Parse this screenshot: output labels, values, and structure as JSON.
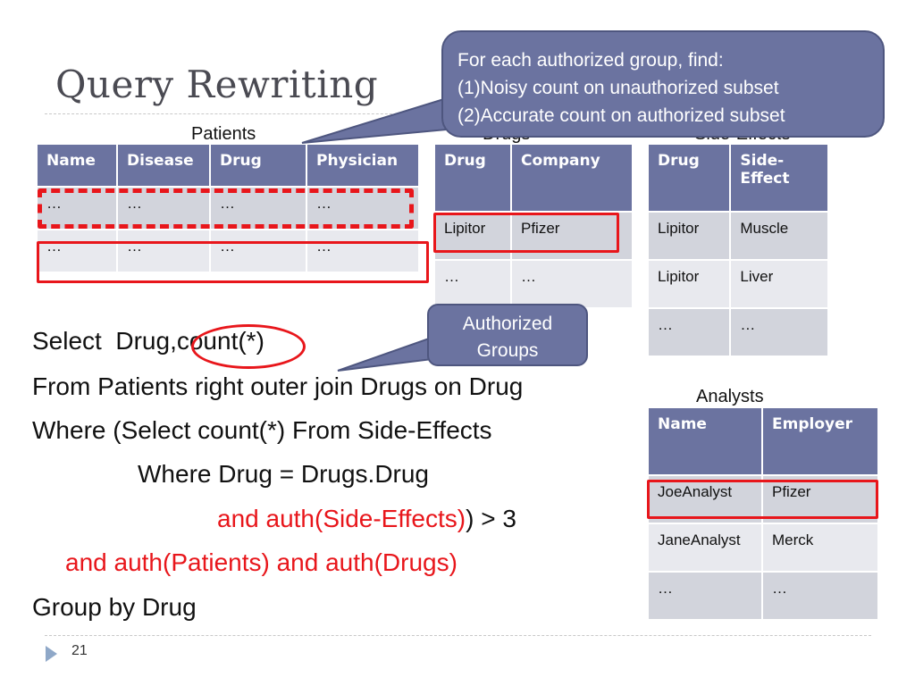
{
  "slide": {
    "title": "Query Rewriting",
    "page_number": "21"
  },
  "callouts": {
    "main": {
      "lines": [
        "For each authorized group, find:",
        "(1)Noisy count on unauthorized subset",
        "(2)Accurate count on authorized subset"
      ]
    },
    "authorized_groups": {
      "lines": [
        "Authorized",
        "Groups"
      ]
    }
  },
  "tables": {
    "patients": {
      "caption": "Patients",
      "headers": [
        "Name",
        "Disease",
        "Drug",
        "Physician"
      ],
      "rows": [
        [
          "…",
          "…",
          "…",
          "…"
        ],
        [
          "…",
          "…",
          "…",
          "…"
        ]
      ]
    },
    "drugs": {
      "caption": "Drugs",
      "headers": [
        "Drug",
        "Company"
      ],
      "rows": [
        [
          "Lipitor",
          "Pfizer"
        ],
        [
          "…",
          "…"
        ]
      ]
    },
    "side_effects": {
      "caption": "Side-Effects",
      "headers": [
        "Drug",
        "Side-Effect"
      ],
      "rows": [
        [
          "Lipitor",
          "Muscle"
        ],
        [
          "Lipitor",
          "Liver"
        ],
        [
          "…",
          "…"
        ]
      ]
    },
    "analysts": {
      "caption": "Analysts",
      "headers": [
        "Name",
        "Employer"
      ],
      "rows": [
        [
          "JoeAnalyst",
          "Pfizer"
        ],
        [
          "JaneAnalyst",
          "Merck"
        ],
        [
          "…",
          "…"
        ]
      ]
    }
  },
  "query": {
    "line1_prefix": "Select  Drug,",
    "line1_count": "count(*)",
    "line2": "From Patients right outer join Drugs on Drug",
    "line3": "Where (Select count(*) From Side-Effects",
    "line4": "Where Drug = Drugs.Drug",
    "line5_red": "and auth(Side-Effects)",
    "line5_rest": ") > 3",
    "line6_red": "and auth(Patients) and auth(Drugs)",
    "line7": "Group by Drug"
  },
  "colors": {
    "header_fill": "#6b73a0",
    "highlight_red": "#e8161b",
    "row_dark": "#d2d4dc",
    "row_light": "#e8e9ee"
  }
}
